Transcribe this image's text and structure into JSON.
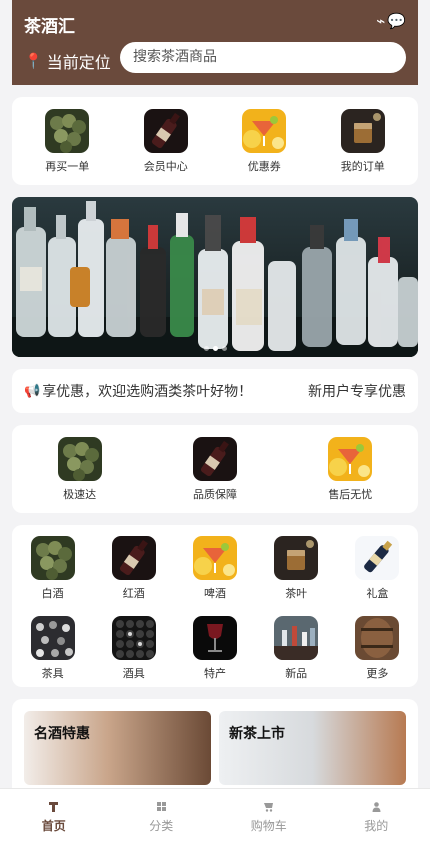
{
  "header": {
    "title": "茶酒汇",
    "location_label": "当前定位",
    "search_placeholder": "搜索茶酒商品",
    "icons": [
      "wave-icon",
      "chat-bubble-icon"
    ]
  },
  "quick_actions": [
    {
      "label": "再买一单",
      "icon": "grapes-icon"
    },
    {
      "label": "会员中心",
      "icon": "wine-bottle-icon"
    },
    {
      "label": "优惠券",
      "icon": "cocktail-icon"
    },
    {
      "label": "我的订单",
      "icon": "whisky-glass-icon"
    }
  ],
  "banner": {
    "slides": 3,
    "active_slide": 2
  },
  "notice": {
    "text": "享优惠，欢迎选购酒类茶叶好物！",
    "promo": "新用户专享优惠"
  },
  "services": [
    {
      "label": "极速达",
      "icon": "grapes-icon"
    },
    {
      "label": "品质保障",
      "icon": "wine-bottle-icon"
    },
    {
      "label": "售后无忧",
      "icon": "cocktail-icon"
    }
  ],
  "categories": [
    {
      "label": "白酒",
      "icon": "grapes-icon"
    },
    {
      "label": "红酒",
      "icon": "wine-bottle-icon"
    },
    {
      "label": "啤酒",
      "icon": "cocktail-icon"
    },
    {
      "label": "茶叶",
      "icon": "whisky-glass-icon"
    },
    {
      "label": "礼盒",
      "icon": "champagne-icon"
    },
    {
      "label": "茶具",
      "icon": "crowd-icon"
    },
    {
      "label": "酒具",
      "icon": "wine-rack-icon"
    },
    {
      "label": "特产",
      "icon": "wine-glass-icon"
    },
    {
      "label": "新品",
      "icon": "bar-icon"
    },
    {
      "label": "更多",
      "icon": "barrel-icon"
    }
  ],
  "features": [
    {
      "title": "名酒特惠"
    },
    {
      "title": "新茶上市"
    }
  ],
  "tabbar": [
    {
      "label": "首页",
      "icon": "home-icon",
      "active": true
    },
    {
      "label": "分类",
      "icon": "grid-icon",
      "active": false
    },
    {
      "label": "购物车",
      "icon": "cart-icon",
      "active": false
    },
    {
      "label": "我的",
      "icon": "user-icon",
      "active": false
    }
  ],
  "colors": {
    "brand": "#6a4a3c",
    "background": "#f3f3f5",
    "pin": "#ff4d4f"
  }
}
